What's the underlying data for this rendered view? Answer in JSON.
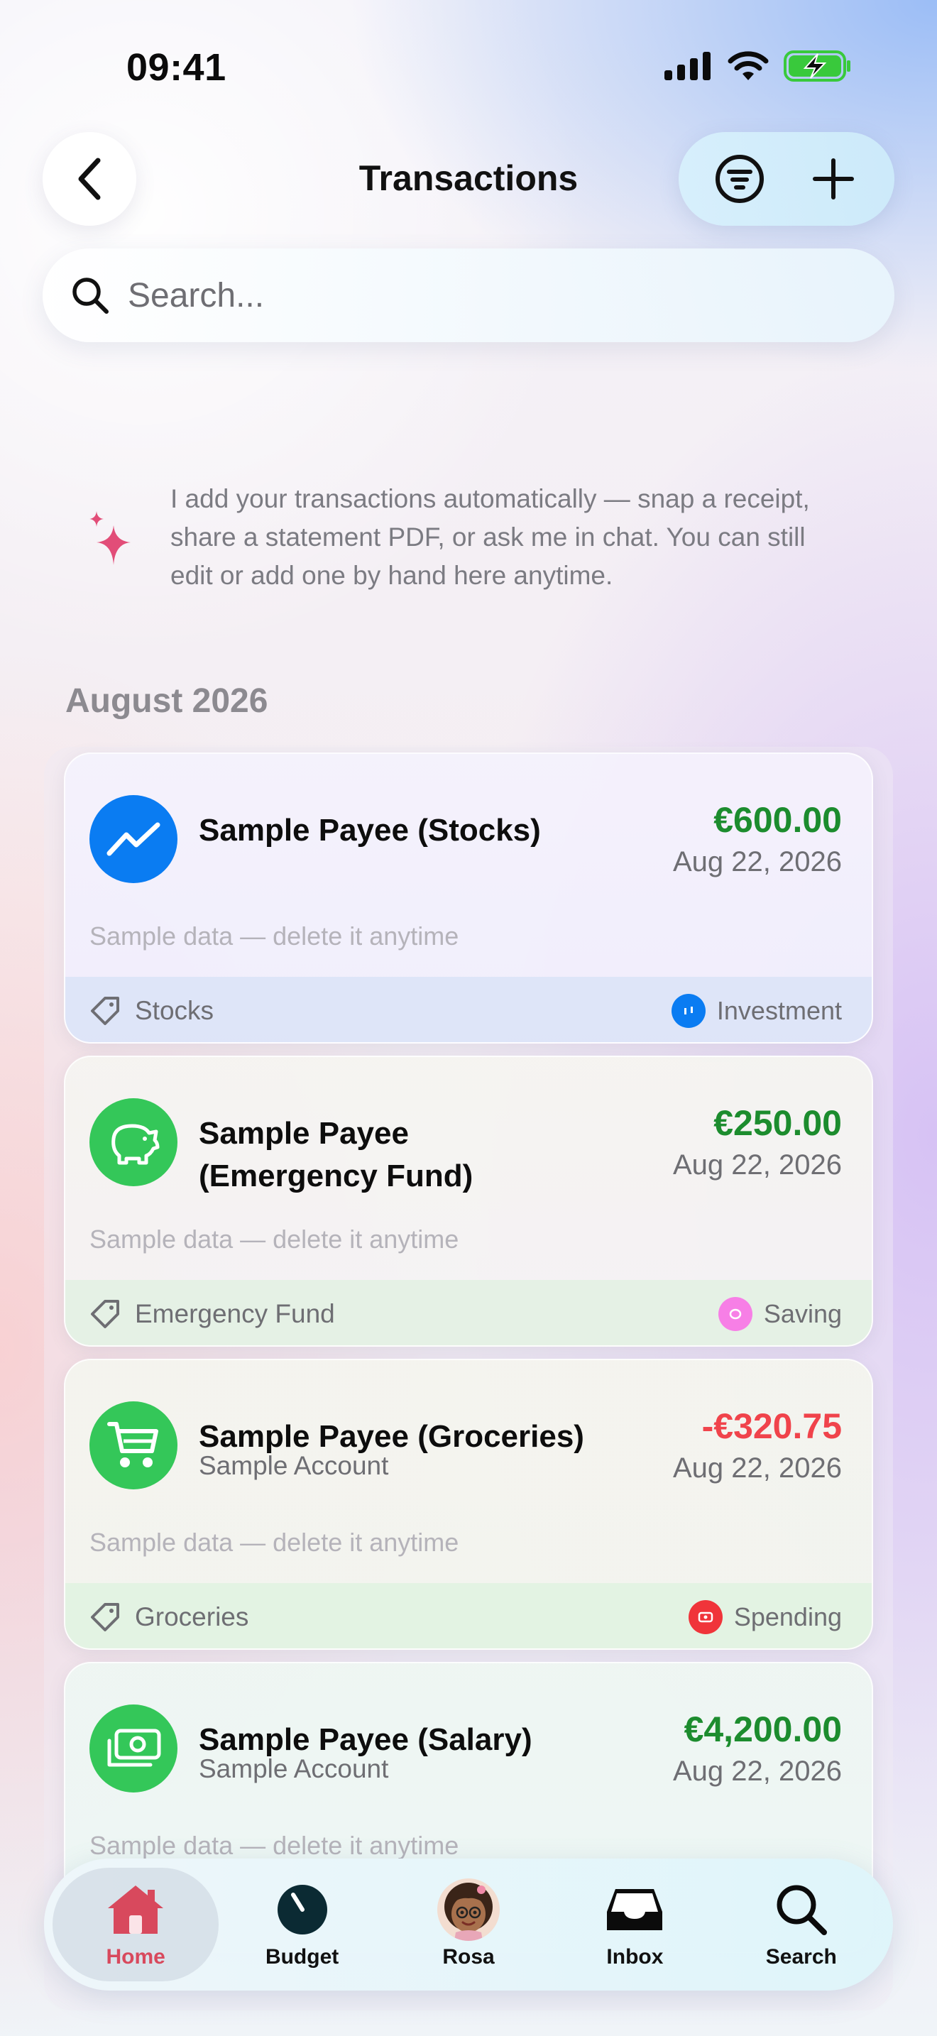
{
  "status_bar": {
    "time": "09:41"
  },
  "header": {
    "title": "Transactions"
  },
  "search": {
    "placeholder": "Search..."
  },
  "info": {
    "text": "I add your transactions automatically — snap a receipt, share a statement PDF, or ask me in chat. You can still edit or add one by hand here anytime."
  },
  "section": {
    "title": "August 2026"
  },
  "transactions": [
    {
      "payee": "Sample Payee (Stocks)",
      "account": "",
      "amount": "€600.00",
      "date": "Aug 22, 2026",
      "note": "Sample data — delete it anytime",
      "tag": "Stocks",
      "type": "Investment",
      "icon": "chart-line-icon",
      "icon_color": "#0a7cf2",
      "amount_color": "#1c8c2e",
      "type_color": "#0a7cf2"
    },
    {
      "payee": "Sample Payee (Emergency Fund)",
      "account": "",
      "amount": "€250.00",
      "date": "Aug 22, 2026",
      "note": "Sample data — delete it anytime",
      "tag": "Emergency Fund",
      "type": "Saving",
      "icon": "piggy-bank-icon",
      "icon_color": "#34c759",
      "amount_color": "#1c8c2e",
      "type_color": "#f77fe6"
    },
    {
      "payee": "Sample Payee (Groceries)",
      "account": "Sample Account",
      "amount": "-€320.75",
      "date": "Aug 22, 2026",
      "note": "Sample data — delete it anytime",
      "tag": "Groceries",
      "type": "Spending",
      "icon": "shopping-cart-icon",
      "icon_color": "#34c759",
      "amount_color": "#f0434b",
      "type_color": "#f0343a"
    },
    {
      "payee": "Sample Payee (Salary)",
      "account": "Sample Account",
      "amount": "€4,200.00",
      "date": "Aug 22, 2026",
      "note": "Sample data — delete it anytime",
      "icon": "money-bill-icon",
      "icon_color": "#34c759",
      "amount_color": "#1c8c2e"
    }
  ],
  "tab_bar": {
    "home": "Home",
    "budget": "Budget",
    "rosa": "Rosa",
    "inbox": "Inbox",
    "search": "Search",
    "active_color": "#d8495d"
  }
}
